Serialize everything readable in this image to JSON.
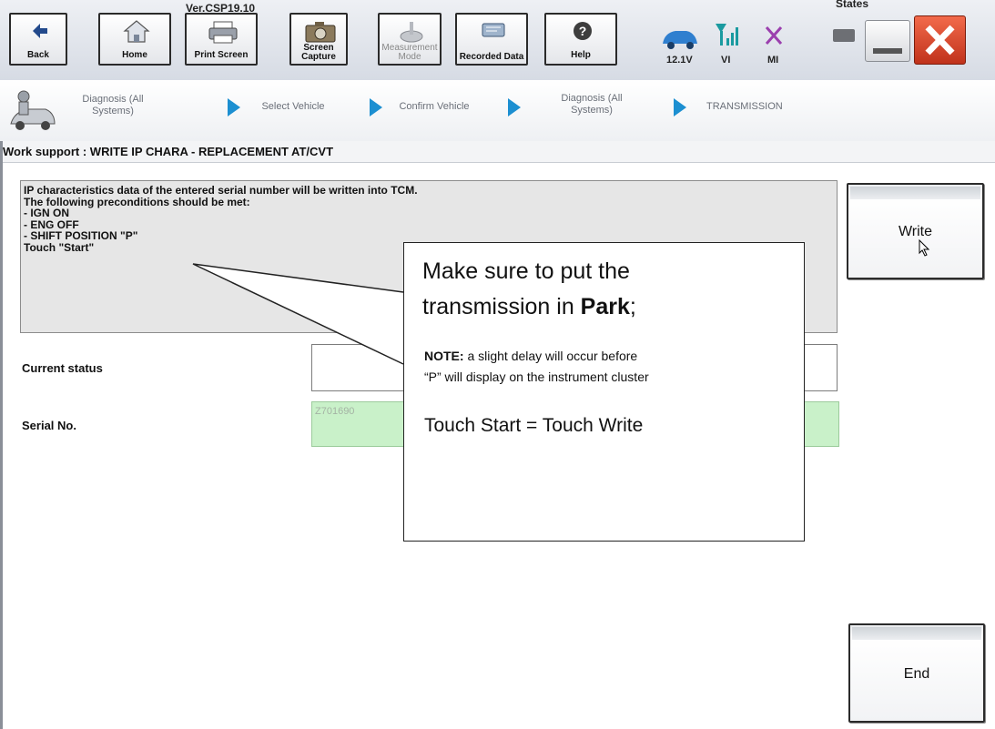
{
  "app": {
    "version": "Ver.CSP19.10",
    "states_label": "States"
  },
  "toolbar": {
    "back_label": "Back",
    "home_label": "Home",
    "print_screen_label": "Print Screen",
    "screen_capture_label": "Screen Capture",
    "measurement_mode_label": "Measurement Mode",
    "recorded_data_label": "Recorded Data",
    "help_label": "Help",
    "battery_voltage": "12.1V",
    "vi_label": "VI",
    "mi_label": "MI"
  },
  "breadcrumb": {
    "items": [
      "Diagnosis (All Systems)",
      "Select Vehicle",
      "Confirm Vehicle",
      "Diagnosis (All Systems)",
      "TRANSMISSION"
    ]
  },
  "work_support": {
    "title": "Work support : WRITE IP CHARA - REPLACEMENT AT/CVT"
  },
  "message": {
    "lines": [
      "IP characteristics data of the entered serial number will be written into TCM.",
      "The following preconditions should be met:",
      "- IGN ON",
      "- ENG OFF",
      "- SHIFT POSITION \"P\"",
      "Touch \"Start\""
    ]
  },
  "fields": {
    "current_status_label": "Current status",
    "current_status_value": "",
    "serial_no_label": "Serial No.",
    "serial_no_value": "Z701690"
  },
  "buttons": {
    "write_label": "Write",
    "end_label": "End"
  },
  "callout": {
    "heading_line1": "Make sure to put the",
    "heading_line2_pre": "transmission in ",
    "heading_line2_bold": "Park",
    "heading_line2_post": ";",
    "note_label": "NOTE:",
    "note_line1": " a slight delay will occur before",
    "note_line2": "“P” will display on the instrument cluster",
    "touch_start": "Touch Start = Touch Write"
  },
  "colors": {
    "breadcrumb_arrow": "#1c8fd1",
    "serial_field_bg": "#c9f1c9",
    "close_button": "#e04a2a"
  }
}
